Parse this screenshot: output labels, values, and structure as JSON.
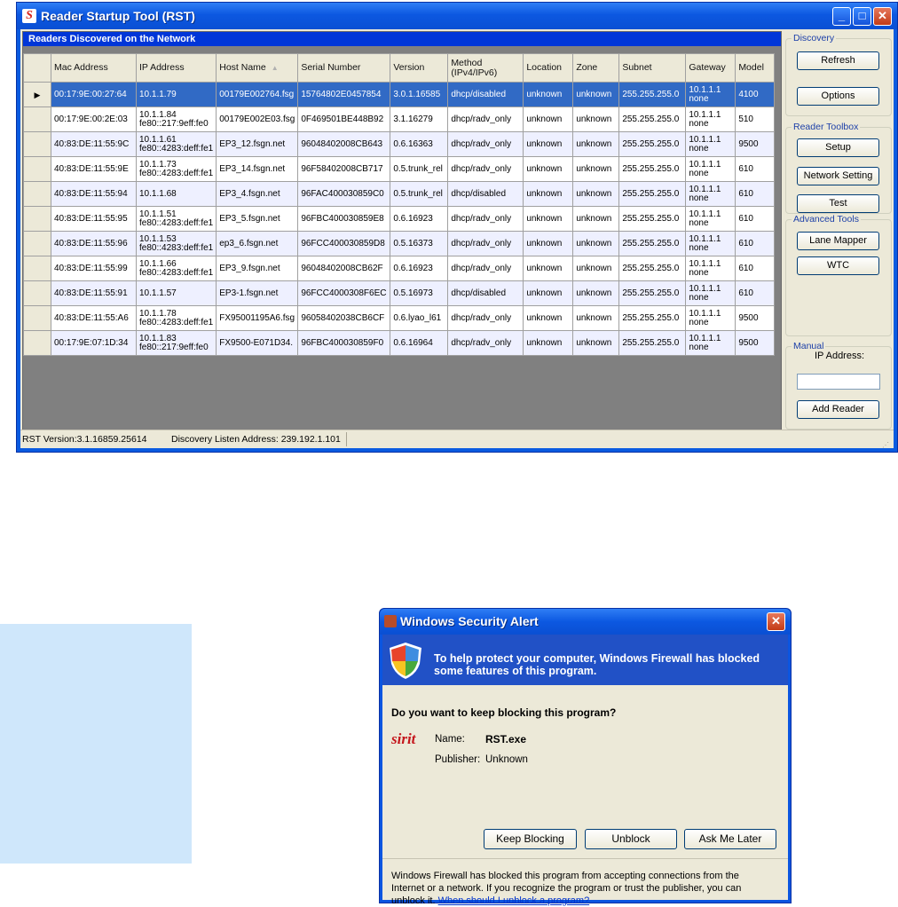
{
  "window": {
    "title": "Reader Startup Tool (RST)",
    "minimize_icon": "minimize-icon",
    "maximize_icon": "maximize-icon",
    "close_icon": "close-icon"
  },
  "grid": {
    "caption": "Readers Discovered on the Network",
    "sort_glyph": "▲",
    "selected_marker": "▶",
    "columns": [
      "Mac Address",
      "IP Address",
      "Host Name",
      "Serial Number",
      "Version",
      "Method (IPv4/IPv6)",
      "Location",
      "Zone",
      "Subnet",
      "Gateway",
      "Model"
    ],
    "rows": [
      {
        "mac": "00:17:9E:00:27:64",
        "ip1": "10.1.1.79",
        "ip2": "",
        "host": "00179E002764.fsg",
        "serial": "15764802E0457854",
        "version": "3.0.1.16585",
        "method": "dhcp/disabled",
        "location": "unknown",
        "zone": "unknown",
        "subnet": "255.255.255.0",
        "gw1": "10.1.1.1",
        "gw2": "none",
        "model": "4100"
      },
      {
        "mac": "00:17:9E:00:2E:03",
        "ip1": "10.1.1.84",
        "ip2": "fe80::217:9eff:fe0",
        "host": "00179E002E03.fsg",
        "serial": "0F469501BE448B92",
        "version": "3.1.16279",
        "method": "dhcp/radv_only",
        "location": "unknown",
        "zone": "unknown",
        "subnet": "255.255.255.0",
        "gw1": "10.1.1.1",
        "gw2": "none",
        "model": "510"
      },
      {
        "mac": "40:83:DE:11:55:9C",
        "ip1": "10.1.1.61",
        "ip2": "fe80::4283:deff:fe1",
        "host": "EP3_12.fsgn.net",
        "serial": "96048402008CB643",
        "version": "0.6.16363",
        "method": "dhcp/radv_only",
        "location": "unknown",
        "zone": "unknown",
        "subnet": "255.255.255.0",
        "gw1": "10.1.1.1",
        "gw2": "none",
        "model": "9500"
      },
      {
        "mac": "40:83:DE:11:55:9E",
        "ip1": "10.1.1.73",
        "ip2": "fe80::4283:deff:fe1",
        "host": "EP3_14.fsgn.net",
        "serial": "96F58402008CB717",
        "version": "0.5.trunk_rel",
        "method": "dhcp/radv_only",
        "location": "unknown",
        "zone": "unknown",
        "subnet": "255.255.255.0",
        "gw1": "10.1.1.1",
        "gw2": "none",
        "model": "610"
      },
      {
        "mac": "40:83:DE:11:55:94",
        "ip1": "10.1.1.68",
        "ip2": "",
        "host": "EP3_4.fsgn.net",
        "serial": "96FAC400030859C0",
        "version": "0.5.trunk_rel",
        "method": "dhcp/disabled",
        "location": "unknown",
        "zone": "unknown",
        "subnet": "255.255.255.0",
        "gw1": "10.1.1.1",
        "gw2": "none",
        "model": "610"
      },
      {
        "mac": "40:83:DE:11:55:95",
        "ip1": "10.1.1.51",
        "ip2": "fe80::4283:deff:fe1",
        "host": "EP3_5.fsgn.net",
        "serial": "96FBC400030859E8",
        "version": "0.6.16923",
        "method": "dhcp/radv_only",
        "location": "unknown",
        "zone": "unknown",
        "subnet": "255.255.255.0",
        "gw1": "10.1.1.1",
        "gw2": "none",
        "model": "610"
      },
      {
        "mac": "40:83:DE:11:55:96",
        "ip1": "10.1.1.53",
        "ip2": "fe80::4283:deff:fe1",
        "host": "ep3_6.fsgn.net",
        "serial": "96FCC400030859D8",
        "version": "0.5.16373",
        "method": "dhcp/radv_only",
        "location": "unknown",
        "zone": "unknown",
        "subnet": "255.255.255.0",
        "gw1": "10.1.1.1",
        "gw2": "none",
        "model": "610"
      },
      {
        "mac": "40:83:DE:11:55:99",
        "ip1": "10.1.1.66",
        "ip2": "fe80::4283:deff:fe1",
        "host": "EP3_9.fsgn.net",
        "serial": "96048402008CB62F",
        "version": "0.6.16923",
        "method": "dhcp/radv_only",
        "location": "unknown",
        "zone": "unknown",
        "subnet": "255.255.255.0",
        "gw1": "10.1.1.1",
        "gw2": "none",
        "model": "610"
      },
      {
        "mac": "40:83:DE:11:55:91",
        "ip1": "10.1.1.57",
        "ip2": "",
        "host": "EP3-1.fsgn.net",
        "serial": "96FCC4000308F6EC",
        "version": "0.5.16973",
        "method": "dhcp/disabled",
        "location": "unknown",
        "zone": "unknown",
        "subnet": "255.255.255.0",
        "gw1": "10.1.1.1",
        "gw2": "none",
        "model": "610"
      },
      {
        "mac": "40:83:DE:11:55:A6",
        "ip1": "10.1.1.78",
        "ip2": "fe80::4283:deff:fe1",
        "host": "FX95001195A6.fsg",
        "serial": "96058402038CB6CF",
        "version": "0.6.lyao_l61",
        "method": "dhcp/radv_only",
        "location": "unknown",
        "zone": "unknown",
        "subnet": "255.255.255.0",
        "gw1": "10.1.1.1",
        "gw2": "none",
        "model": "9500"
      },
      {
        "mac": "00:17:9E:07:1D:34",
        "ip1": "10.1.1.83",
        "ip2": "fe80::217:9eff:fe0",
        "host": "FX9500-E071D34.",
        "serial": "96FBC400030859F0",
        "version": "0.6.16964",
        "method": "dhcp/radv_only",
        "location": "unknown",
        "zone": "unknown",
        "subnet": "255.255.255.0",
        "gw1": "10.1.1.1",
        "gw2": "none",
        "model": "9500"
      }
    ]
  },
  "sidebar": {
    "discovery": {
      "title": "Discovery",
      "refresh": "Refresh",
      "options": "Options"
    },
    "toolbox": {
      "title": "Reader Toolbox",
      "setup": "Setup",
      "network": "Network Setting",
      "test": "Test"
    },
    "advanced": {
      "title": "Advanced Tools",
      "lane_mapper": "Lane Mapper",
      "wtc": "WTC"
    },
    "manual": {
      "title": "Manual",
      "ip_label": "IP Address:",
      "ip_value": "",
      "add": "Add Reader"
    }
  },
  "status": {
    "version": "RST Version:3.1.16859.25614",
    "listen": "Discovery Listen Address: 239.192.1.101"
  },
  "alert": {
    "title": "Windows Security Alert",
    "banner_line1": "To help protect your computer,  Windows Firewall has blocked",
    "banner_line2": "some features of this program.",
    "question": "Do you want to keep blocking this program?",
    "name_label": "Name:",
    "name_value": "RST.exe",
    "publisher_label": "Publisher:",
    "publisher_value": "Unknown",
    "program_logo": "sirit",
    "keep_blocking": "Keep Blocking",
    "unblock": "Unblock",
    "ask_later": "Ask Me Later",
    "footer_line1": "Windows Firewall has blocked this program from accepting connections from the",
    "footer_line2": "Internet or a network. If you recognize the program or trust the publisher, you can",
    "footer_line3": "unblock it.",
    "footer_link": "When should I unblock a program?"
  },
  "colors": {
    "titlebar": "#0c58e1",
    "caption": "#0036d8",
    "selected_row": "#316ac5",
    "side_box": "#cfe7fb"
  }
}
